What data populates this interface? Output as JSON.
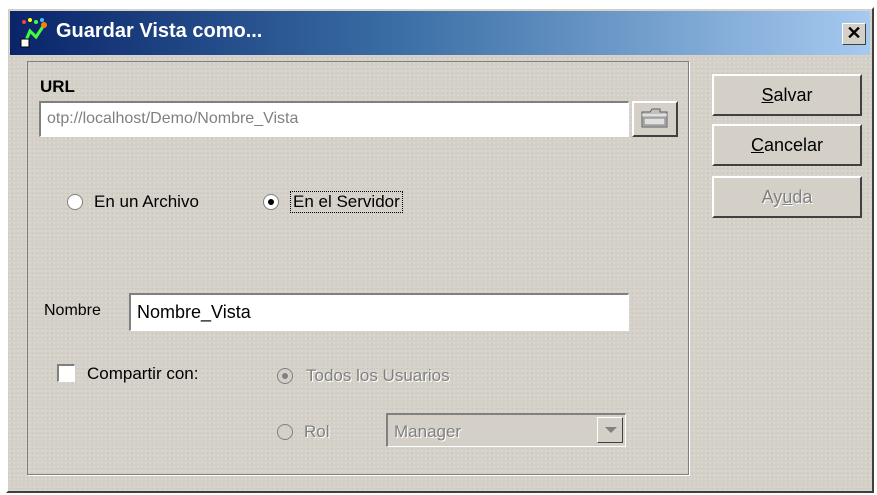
{
  "window": {
    "title": "Guardar Vista como...",
    "close_glyph": "✕",
    "title_icon": "save-view-icon"
  },
  "url_section": {
    "label": "URL",
    "value": "otp://localhost/Demo/Nombre_Vista",
    "browse_icon": "folder-icon"
  },
  "location": {
    "options": [
      {
        "label": "En un Archivo",
        "selected": false
      },
      {
        "label": "En el Servidor",
        "selected": true
      }
    ]
  },
  "name_section": {
    "label": "Nombre",
    "value": "Nombre_Vista"
  },
  "share": {
    "checkbox_label": "Compartir con:",
    "checked": false,
    "options": [
      {
        "label": "Todos los Usuarios",
        "selected": true,
        "enabled": false
      },
      {
        "label": "Rol",
        "selected": false,
        "enabled": false
      }
    ],
    "role_value": "Manager"
  },
  "buttons": {
    "save": {
      "prefix": "",
      "mnemonic": "S",
      "rest": "alvar",
      "enabled": true
    },
    "cancel": {
      "prefix": "",
      "mnemonic": "C",
      "rest": "ancelar",
      "enabled": true
    },
    "help": {
      "prefix": "Ay",
      "mnemonic": "u",
      "rest": "da",
      "enabled": false
    }
  },
  "colors": {
    "title_gradient_start": "#0a246a",
    "title_gradient_end": "#a6caf0",
    "face": "#d4d0c8",
    "disabled_text": "#808080"
  }
}
